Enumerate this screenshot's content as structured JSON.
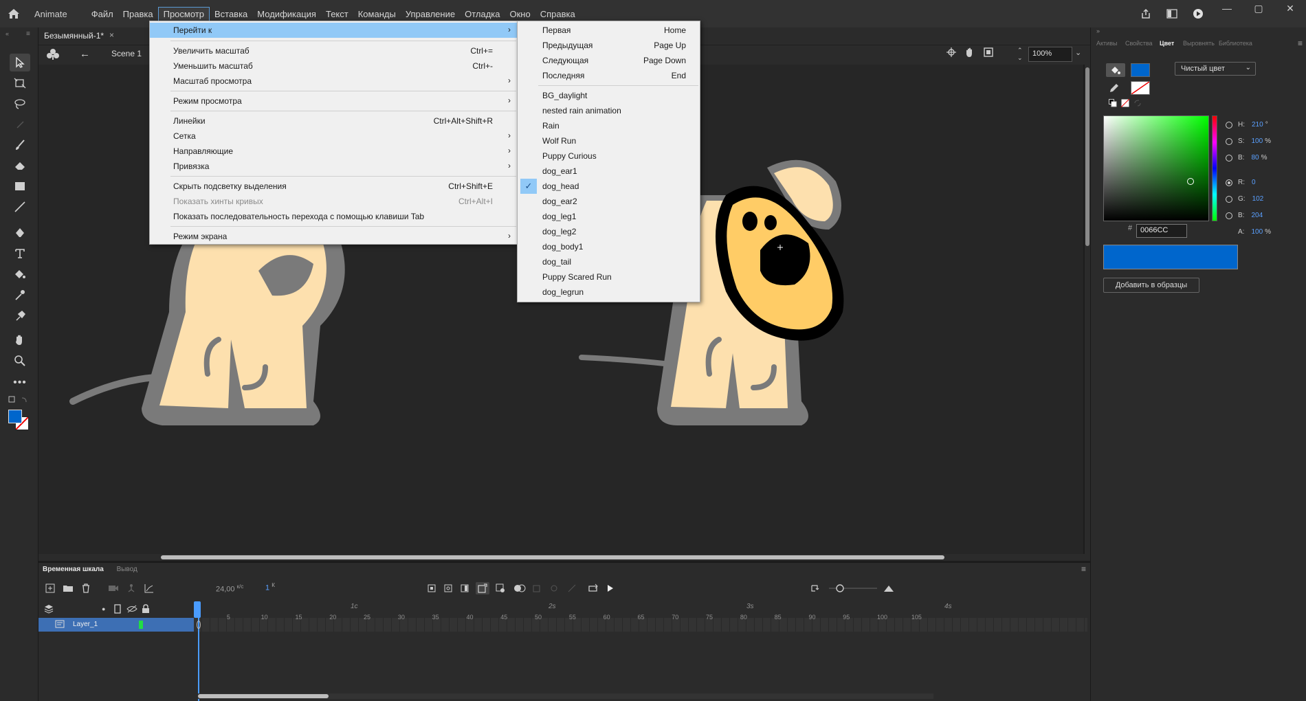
{
  "app": {
    "name": "Animate"
  },
  "menus": [
    "Файл",
    "Правка",
    "Просмотр",
    "Вставка",
    "Модификация",
    "Текст",
    "Команды",
    "Управление",
    "Отладка",
    "Окно",
    "Справка"
  ],
  "document": {
    "tab_title": "Безымянный-1*",
    "close": "×",
    "scene": "Scene 1",
    "zoom": "100%"
  },
  "view_menu": {
    "goto": {
      "label": "Перейти к"
    },
    "zoom_in": {
      "label": "Увеличить масштаб",
      "shortcut": "Ctrl+="
    },
    "zoom_out": {
      "label": "Уменьшить масштаб",
      "shortcut": "Ctrl+-"
    },
    "magnification": {
      "label": "Масштаб просмотра"
    },
    "preview_mode": {
      "label": "Режим просмотра"
    },
    "rulers": {
      "label": "Линейки",
      "shortcut": "Ctrl+Alt+Shift+R"
    },
    "grid": {
      "label": "Сетка"
    },
    "guides": {
      "label": "Направляющие"
    },
    "snapping": {
      "label": "Привязка"
    },
    "hide_highlight": {
      "label": "Скрыть подсветку выделения",
      "shortcut": "Ctrl+Shift+E"
    },
    "show_hints": {
      "label": "Показать хинты кривых",
      "shortcut": "Ctrl+Alt+I"
    },
    "show_tab_order": {
      "label": "Показать последовательность перехода с помощью клавиши Tab"
    },
    "screen_mode": {
      "label": "Режим экрана"
    }
  },
  "goto_menu": {
    "first": {
      "label": "Первая",
      "shortcut": "Home"
    },
    "previous": {
      "label": "Предыдущая",
      "shortcut": "Page Up"
    },
    "next": {
      "label": "Следующая",
      "shortcut": "Page Down"
    },
    "last": {
      "label": "Последняя",
      "shortcut": "End"
    },
    "scenes": [
      "BG_daylight",
      "nested rain animation",
      "Rain",
      "Wolf Run",
      "Puppy Curious",
      "dog_ear1",
      "dog_head",
      "dog_ear2",
      "dog_leg1",
      "dog_leg2",
      "dog_body1",
      "dog_tail",
      "Puppy Scared Run",
      "dog_legrun"
    ],
    "checked": "dog_head",
    "check_mark": "✓"
  },
  "timeline": {
    "tab_timeline": "Временная шкала",
    "tab_output": "Вывод",
    "fps": "24,00",
    "fps_unit": "к/с",
    "frame": "1",
    "frame_unit": "К",
    "layer_name": "Layer_1",
    "second_labels": [
      "1с",
      "2s",
      "3s",
      "4s"
    ],
    "frame_ticks": [
      "5",
      "10",
      "15",
      "20",
      "25",
      "30",
      "35",
      "40",
      "45",
      "50",
      "55",
      "60",
      "65",
      "70",
      "75",
      "80",
      "85",
      "90",
      "95",
      "100",
      "105"
    ]
  },
  "right_panel": {
    "tabs": {
      "assets": "Активы",
      "properties": "Свойства",
      "color": "Цвет",
      "align": "Выровнять",
      "library": "Библиотека"
    },
    "color_type": "Чистый цвет",
    "fields": {
      "h": {
        "label": "H:",
        "value": "210",
        "unit": "°"
      },
      "s": {
        "label": "S:",
        "value": "100",
        "unit": "%"
      },
      "b": {
        "label": "B:",
        "value": "80",
        "unit": "%"
      },
      "r": {
        "label": "R:",
        "value": "0"
      },
      "g": {
        "label": "G:",
        "value": "102"
      },
      "bl": {
        "label": "B:",
        "value": "204"
      },
      "a": {
        "label": "A:",
        "value": "100",
        "unit": "%"
      }
    },
    "hex_label": "#",
    "hex": "0066CC",
    "add_swatch": "Добавить в образцы"
  },
  "colors": {
    "fill": "#0066cc",
    "stroke": "#ffffff",
    "dog_body": "#fde0ae",
    "dog_outline": "#7a7a7a",
    "dog_head": "#ffcc66",
    "highlight": "#91c9f7"
  }
}
